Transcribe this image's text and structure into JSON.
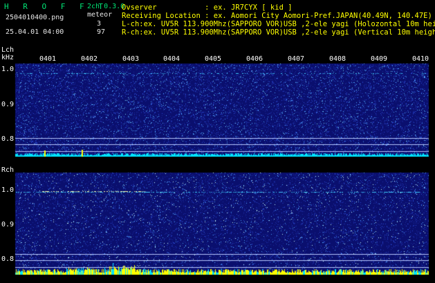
{
  "header": {
    "brand": "H R O F F T",
    "version": "2ch 0.3.0",
    "filename": "2504010400.png",
    "datetime": "25.04.01 04:00",
    "meteor_label": "meteor",
    "meteor_l": "3",
    "meteor_r": "97",
    "observer": "Ovserver           : ex. JR7CYX [ kid ]",
    "location": "Receiving Location : ex. Aomori City Aomori-Pref.JAPAN(40.49N, 140.47E)",
    "lch_info": "L-ch:ex. UV5R 113.900Mhz(SAPPORO VOR)USB ,2-ele yagi (Holozontal 10m height)",
    "rch_info": "R-ch:ex. UV5R 113.900Mhz(SAPPORO VOR)USB ,2-ele yagi (Vertical 10m height)"
  },
  "lch": {
    "label": "Lch",
    "unit": "kHz",
    "yticks": [
      "1.0",
      "0.9",
      "0.8"
    ]
  },
  "rch": {
    "label": "Rch",
    "yticks": [
      "1.0",
      "0.9",
      "0.8"
    ]
  },
  "xticks": [
    "0401",
    "0402",
    "0403",
    "0404",
    "0405",
    "0406",
    "0407",
    "0408",
    "0409",
    "0410"
  ],
  "colors": {
    "background": "#000000",
    "header_green": "#00e676",
    "header_white": "#e8e8e8",
    "spectrum_dark": "#0a0f6e",
    "noise_cyan": "#00e5ff",
    "meteor_yellow": "#ffff00"
  }
}
